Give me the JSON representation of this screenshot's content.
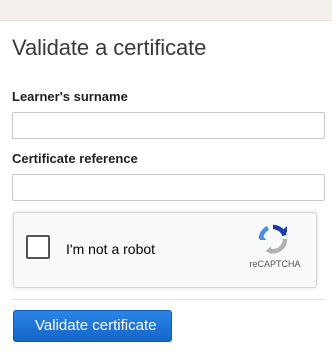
{
  "form": {
    "title": "Validate a certificate",
    "surname": {
      "label": "Learner's surname",
      "value": "",
      "placeholder": ""
    },
    "reference": {
      "label": "Certificate reference",
      "value": "",
      "placeholder": ""
    },
    "recaptcha": {
      "checkbox_label": "I'm not a robot",
      "brand": "reCAPTCHA",
      "checked": false,
      "colors": {
        "arrow_blue": "#4a90e2",
        "arrow_dark_blue": "#1c3aa9",
        "arrow_grey": "#b0b0b0"
      }
    },
    "submit_label": "Validate certificate",
    "colors": {
      "button": "#1a73d9",
      "heading": "#3a3a3a"
    }
  }
}
